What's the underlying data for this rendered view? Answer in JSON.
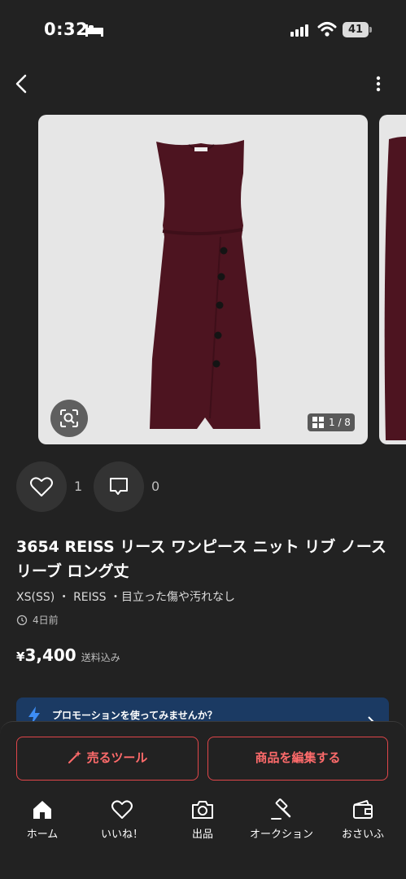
{
  "status_bar": {
    "time": "0:32",
    "battery": "41"
  },
  "gallery": {
    "counter": "1 / 8",
    "dress_tag": "REISS"
  },
  "reactions": {
    "likes": "1",
    "comments": "0"
  },
  "product": {
    "title": "3654 REISS リース ワンピース ニット リブ ノースリーブ ロング丈",
    "meta": "XS(SS) ・ REISS ・目立った傷や汚れなし",
    "posted": "4日前",
    "price_symbol": "¥",
    "price": "3,400",
    "shipping": "送料込み"
  },
  "promo": {
    "text": "プロモーションを使ってみませんか？"
  },
  "actions": {
    "sell_tool": "売るツール",
    "edit": "商品を編集する"
  },
  "tabs": [
    {
      "label": "ホーム"
    },
    {
      "label": "いいね！"
    },
    {
      "label": "出品"
    },
    {
      "label": "オークション"
    },
    {
      "label": "おさいふ"
    }
  ],
  "colors": {
    "background": "#222222",
    "accent": "#e0464a",
    "promo_bg": "#1b3a63",
    "dress": "#4d1420"
  }
}
